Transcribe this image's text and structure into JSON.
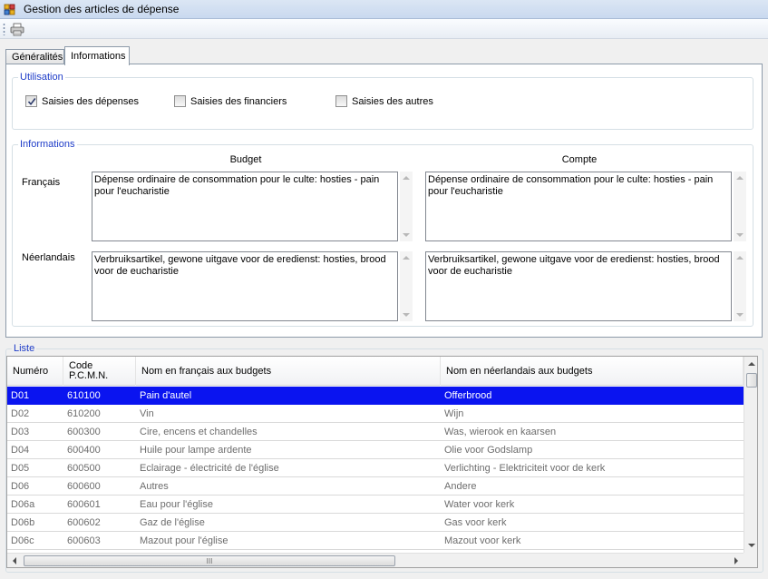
{
  "window": {
    "title": "Gestion des articles de dépense",
    "icon": "app-icon"
  },
  "toolbar": {
    "print_icon": "printer-icon"
  },
  "tabs": [
    {
      "label": "Généralités",
      "active": false
    },
    {
      "label": "Informations",
      "active": true
    }
  ],
  "utilisation": {
    "legend": "Utilisation",
    "checkboxes": [
      {
        "label": "Saisies des dépenses",
        "checked": true
      },
      {
        "label": "Saisies des financiers",
        "checked": false
      },
      {
        "label": "Saisies des autres",
        "checked": false
      }
    ]
  },
  "informations": {
    "legend": "Informations",
    "col_budget": "Budget",
    "col_compte": "Compte",
    "row_fr": "Français",
    "row_nl": "Néerlandais",
    "fr_budget": "Dépense ordinaire de consommation pour le culte: hosties - pain pour l'eucharistie",
    "fr_compte": "Dépense ordinaire de consommation pour le culte: hosties - pain pour l'eucharistie",
    "nl_budget": "Verbruiksartikel, gewone uitgave voor de eredienst: hosties, brood voor de eucharistie",
    "nl_compte": "Verbruiksartikel, gewone uitgave voor de eredienst: hosties, brood voor de eucharistie"
  },
  "liste": {
    "legend": "Liste",
    "columns": {
      "numero": "Numéro",
      "code_line1": "Code",
      "code_line2": "P.C.M.N.",
      "nom_fr": "Nom en français aux budgets",
      "nom_nl": "Nom en néerlandais aux budgets"
    },
    "rows": [
      {
        "numero": "D01",
        "code": "610100",
        "fr": "Pain d'autel",
        "nl": "Offerbrood",
        "selected": true
      },
      {
        "numero": "D02",
        "code": "610200",
        "fr": "Vin",
        "nl": "Wijn",
        "selected": false
      },
      {
        "numero": "D03",
        "code": "600300",
        "fr": "Cire, encens et chandelles",
        "nl": "Was, wierook en kaarsen",
        "selected": false
      },
      {
        "numero": "D04",
        "code": "600400",
        "fr": "Huile pour lampe ardente",
        "nl": "Olie voor Godslamp",
        "selected": false
      },
      {
        "numero": "D05",
        "code": "600500",
        "fr": "Eclairage - électricité de l'église",
        "nl": "Verlichting - Elektriciteit voor de  kerk",
        "selected": false
      },
      {
        "numero": "D06",
        "code": "600600",
        "fr": "Autres",
        "nl": "Andere",
        "selected": false
      },
      {
        "numero": "D06a",
        "code": "600601",
        "fr": "Eau pour l'église",
        "nl": "Water voor kerk",
        "selected": false
      },
      {
        "numero": "D06b",
        "code": "600602",
        "fr": "Gaz de l'église",
        "nl": "Gas voor kerk",
        "selected": false
      },
      {
        "numero": "D06c",
        "code": "600603",
        "fr": "Mazout pour l'église",
        "nl": "Mazout voor kerk",
        "selected": false
      }
    ],
    "hscroll_grip": "III"
  },
  "colors": {
    "accent": "#1e3cc8",
    "selection": "#0a14f0"
  }
}
